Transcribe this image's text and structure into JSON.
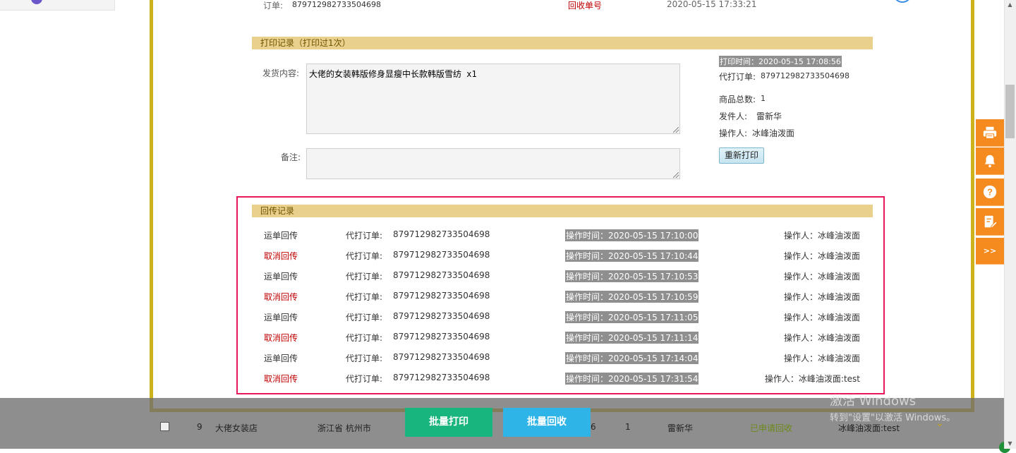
{
  "order_top": {
    "label": "订单:",
    "value": "879712982733504698",
    "recycle_label": "回收单号",
    "time": "2020-05-15 17:33:21"
  },
  "print_record": {
    "title": "打印记录（打印过1次）",
    "content_label": "发货内容:",
    "content_value": "大佬的女装韩版修身显瘦中长款韩版雪纺 x1",
    "remark_label": "备注:",
    "remark_value": "",
    "print_time": "打印时间：2020-05-15 17:08:56",
    "proxy_order_label": "代打订单:",
    "proxy_order_value": "879712982733504698",
    "total_label": "商品总数:",
    "total_value": "1",
    "sender_label": "发件人:",
    "sender_value": "雷新华",
    "operator_label": "操作人:",
    "operator_value": "冰峰油泼面",
    "reprint_button": "重新打印"
  },
  "callback_record": {
    "title": "回传记录",
    "rows": [
      {
        "type": "运单回传",
        "is_cancel": false,
        "order_label": "代打订单:",
        "order": "879712982733504698",
        "time": "操作时间：2020-05-15 17:10:00",
        "operator": "操作人：冰峰油泼面"
      },
      {
        "type": "取消回传",
        "is_cancel": true,
        "order_label": "代打订单:",
        "order": "879712982733504698",
        "time": "操作时间：2020-05-15 17:10:44",
        "operator": "操作人：冰峰油泼面"
      },
      {
        "type": "运单回传",
        "is_cancel": false,
        "order_label": "代打订单:",
        "order": "879712982733504698",
        "time": "操作时间：2020-05-15 17:10:53",
        "operator": "操作人：冰峰油泼面"
      },
      {
        "type": "取消回传",
        "is_cancel": true,
        "order_label": "代打订单:",
        "order": "879712982733504698",
        "time": "操作时间：2020-05-15 17:10:59",
        "operator": "操作人：冰峰油泼面"
      },
      {
        "type": "运单回传",
        "is_cancel": false,
        "order_label": "代打订单:",
        "order": "879712982733504698",
        "time": "操作时间：2020-05-15 17:11:05",
        "operator": "操作人：冰峰油泼面"
      },
      {
        "type": "取消回传",
        "is_cancel": true,
        "order_label": "代打订单:",
        "order": "879712982733504698",
        "time": "操作时间：2020-05-15 17:11:14",
        "operator": "操作人：冰峰油泼面"
      },
      {
        "type": "运单回传",
        "is_cancel": false,
        "order_label": "代打订单:",
        "order": "879712982733504698",
        "time": "操作时间：2020-05-15 17:14:04",
        "operator": "操作人：冰峰油泼面"
      },
      {
        "type": "取消回传",
        "is_cancel": true,
        "order_label": "代打订单:",
        "order": "879712982733504698",
        "time": "操作时间：2020-05-15 17:31:54",
        "operator": "操作人：冰峰油泼面:test"
      }
    ]
  },
  "bottom_row": {
    "index": "9",
    "shop": "大佬女装店",
    "region": "浙江省 杭州市",
    "partial_num": "6",
    "qty": "1",
    "sender": "雷新华",
    "status": "已申请回收",
    "operator": "冰峰油泼面:test"
  },
  "actions": {
    "batch_print": "批量打印",
    "batch_recycle": "批量回收"
  },
  "watermark": {
    "line1": "激活 Windows",
    "line2": "转到\"设置\"以激活 Windows。"
  },
  "float_tools": {
    "more": ">>"
  },
  "colors": {
    "panel_border": "#cdb21c",
    "section_bar": "#e9d08c",
    "highlight_box": "#e8185a",
    "cancel_text": "#c00000",
    "float_orange": "#f58a1f",
    "batch_print_green": "#18b57e",
    "batch_recycle_blue": "#2eb4e6"
  }
}
